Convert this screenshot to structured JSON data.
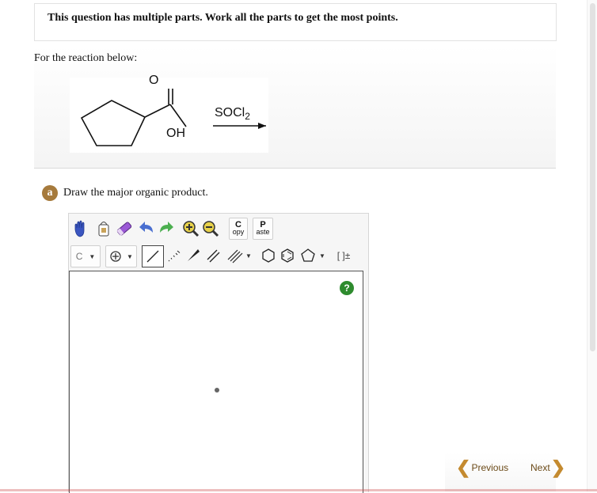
{
  "header": {
    "title": "This question has multiple parts. Work all the parts to get the most points."
  },
  "question": {
    "intro": "For the reaction below:",
    "reaction": {
      "oxygen_label": "O",
      "hydroxyl_label": "OH",
      "reagent_main": "SOCl",
      "reagent_subscript": "2"
    }
  },
  "part_a": {
    "badge": "a",
    "prompt": "Draw the major organic product."
  },
  "toolbar": {
    "copy_label_top": "C",
    "copy_label_bottom": "opy",
    "paste_label_top": "P",
    "paste_label_bottom": "aste",
    "element_selector": "C",
    "bracket_label": "[ ]±"
  },
  "canvas": {
    "help_label": "?"
  },
  "navigation": {
    "previous_label": "Previous",
    "next_label": "Next"
  },
  "colors": {
    "badge": "#a67a3c",
    "nav_chevron": "#c48a2f",
    "help": "#2e8b2e"
  }
}
